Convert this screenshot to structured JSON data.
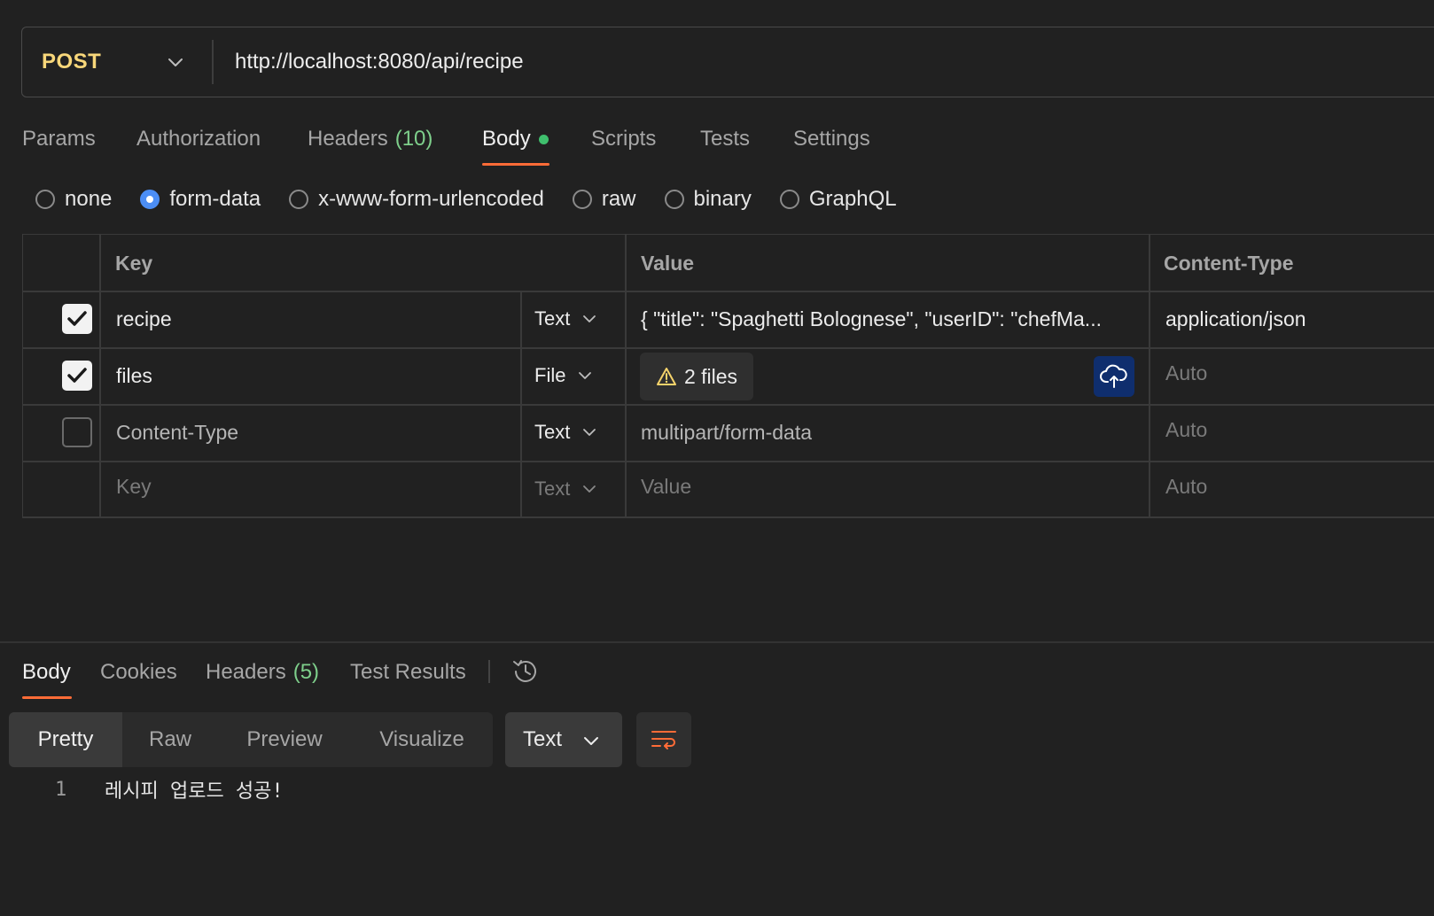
{
  "request": {
    "method": "POST",
    "url": "http://localhost:8080/api/recipe"
  },
  "tabs": [
    {
      "label": "Params"
    },
    {
      "label": "Authorization"
    },
    {
      "label": "Headers",
      "count": "(10)"
    },
    {
      "label": "Body",
      "active": true
    },
    {
      "label": "Scripts"
    },
    {
      "label": "Tests"
    },
    {
      "label": "Settings"
    }
  ],
  "body_modes": [
    {
      "label": "none"
    },
    {
      "label": "form-data",
      "selected": true
    },
    {
      "label": "x-www-form-urlencoded"
    },
    {
      "label": "raw"
    },
    {
      "label": "binary"
    },
    {
      "label": "GraphQL"
    }
  ],
  "table": {
    "headers": {
      "key": "Key",
      "value": "Value",
      "content_type": "Content-Type"
    },
    "rows": [
      {
        "checked": true,
        "key": "recipe",
        "type": "Text",
        "value": "{ \"title\": \"Spaghetti Bolognese\", \"userID\": \"chefMa...",
        "content_type": "application/json"
      },
      {
        "checked": true,
        "key": "files",
        "type": "File",
        "value": "2 files",
        "content_type": "Auto"
      },
      {
        "checked": false,
        "key": "Content-Type",
        "type": "Text",
        "value": "multipart/form-data",
        "content_type": "Auto"
      },
      {
        "key_placeholder": "Key",
        "type": "Text",
        "value_placeholder": "Value",
        "content_type": "Auto"
      }
    ]
  },
  "response": {
    "tabs": [
      {
        "label": "Body",
        "active": true
      },
      {
        "label": "Cookies"
      },
      {
        "label": "Headers",
        "count": "(5)"
      },
      {
        "label": "Test Results"
      }
    ],
    "view_modes": [
      {
        "label": "Pretty",
        "selected": true
      },
      {
        "label": "Raw"
      },
      {
        "label": "Preview"
      },
      {
        "label": "Visualize"
      }
    ],
    "format": "Text",
    "lines": [
      {
        "number": "1",
        "text": "레시피 업로드 성공!"
      }
    ]
  },
  "colors": {
    "background": "#212121",
    "method": "#f8d77a",
    "accent": "#ff6c37",
    "success_dot": "#3fbf6d",
    "count": "#7ecf8b",
    "radio_selected": "#4c8ef5",
    "upload_button": "#0f2e6e",
    "warning_icon": "#f5d36b"
  },
  "icons": [
    "chevron-down-icon",
    "warning-icon",
    "cloud-upload-icon",
    "history-icon",
    "wrap-lines-icon",
    "check-icon"
  ]
}
